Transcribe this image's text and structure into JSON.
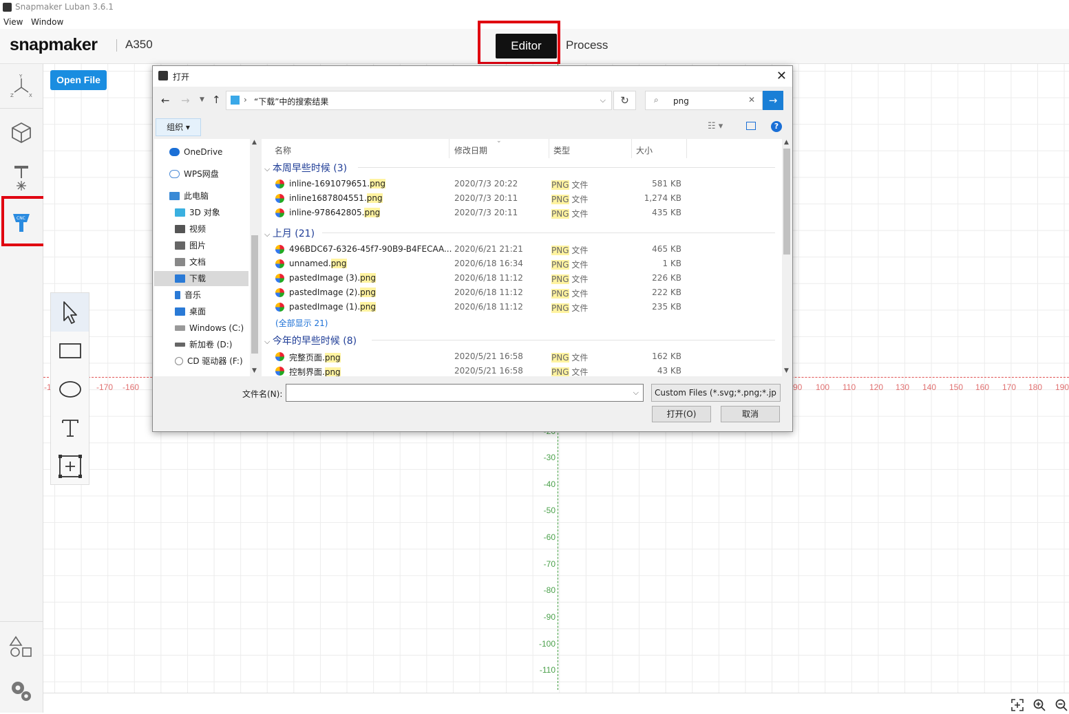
{
  "app": {
    "title": "Snapmaker Luban 3.6.1",
    "menu": [
      "View",
      "Window"
    ]
  },
  "header": {
    "logo": "snapmaker",
    "machine": "A350",
    "tabs": {
      "editor": "Editor",
      "process": "Process"
    }
  },
  "sidebar": {
    "items": [
      "axes-icon",
      "cube-icon",
      "laser-icon",
      "cnc-icon",
      "shapes-icon",
      "gear-icon"
    ],
    "active": "cnc-icon"
  },
  "toolbar": {
    "open_file": "Open File"
  },
  "canvas": {
    "x_ticks_left": [
      "-1",
      "-170",
      "-160"
    ],
    "x_ticks_right": [
      "90",
      "100",
      "110",
      "120",
      "130",
      "140",
      "150",
      "160",
      "170",
      "180",
      "190"
    ],
    "y_ticks": [
      "-20",
      "-30",
      "-40",
      "-50",
      "-60",
      "-70",
      "-80",
      "-90",
      "-100",
      "-110"
    ]
  },
  "tools": [
    "pointer-icon",
    "rectangle-icon",
    "ellipse-icon",
    "text-icon",
    "add-frame-icon"
  ],
  "dialog": {
    "title": "打开",
    "breadcrumb": "“下载”中的搜索结果",
    "search_value": "png",
    "organize": "组织 ▾",
    "tree": [
      {
        "label": "OneDrive",
        "icon": "cloud-icon",
        "color": "#1a6fd6"
      },
      {
        "label": "WPS网盘",
        "icon": "cloud-outline-icon",
        "color": "#4a8ad6"
      },
      {
        "label": "此电脑",
        "icon": "computer-icon",
        "color": "#3a8ad6"
      },
      {
        "label": "3D 对象",
        "icon": "3d-objects-icon",
        "color": "#3ab0e0"
      },
      {
        "label": "视频",
        "icon": "video-icon",
        "color": "#555"
      },
      {
        "label": "图片",
        "icon": "pictures-icon",
        "color": "#666"
      },
      {
        "label": "文档",
        "icon": "documents-icon",
        "color": "#777"
      },
      {
        "label": "下载",
        "icon": "download-icon",
        "color": "#2a7ad6"
      },
      {
        "label": "音乐",
        "icon": "music-icon",
        "color": "#2a7ad6"
      },
      {
        "label": "桌面",
        "icon": "desktop-icon",
        "color": "#2a7ad6"
      },
      {
        "label": "Windows (C:)",
        "icon": "drive-c-icon",
        "color": "#888"
      },
      {
        "label": "新加卷 (D:)",
        "icon": "drive-d-icon",
        "color": "#666"
      },
      {
        "label": "CD 驱动器 (F:)",
        "icon": "cd-drive-icon",
        "color": "#888"
      }
    ],
    "columns": [
      "名称",
      "修改日期",
      "类型",
      "大小"
    ],
    "groups": [
      {
        "title": "本周早些时候 (3)",
        "files": [
          {
            "name": "inline-1691079651.",
            "ext": "png",
            "date": "2020/7/3 20:22",
            "type_ext": "PNG",
            "type": " 文件",
            "size": "581 KB"
          },
          {
            "name": "inline1687804551.",
            "ext": "png",
            "date": "2020/7/3 20:11",
            "type_ext": "PNG",
            "type": " 文件",
            "size": "1,274 KB"
          },
          {
            "name": "inline-978642805.",
            "ext": "png",
            "date": "2020/7/3 20:11",
            "type_ext": "PNG",
            "type": " 文件",
            "size": "435 KB"
          }
        ]
      },
      {
        "title": "上月 (21)",
        "files": [
          {
            "name": "496BDC67-6326-45f7-90B9-B4FECAA...",
            "ext": "",
            "date": "2020/6/21 21:21",
            "type_ext": "PNG",
            "type": " 文件",
            "size": "465 KB"
          },
          {
            "name": "unnamed.",
            "ext": "png",
            "date": "2020/6/18 16:34",
            "type_ext": "PNG",
            "type": " 文件",
            "size": "1 KB"
          },
          {
            "name": "pastedImage (3).",
            "ext": "png",
            "date": "2020/6/18 11:12",
            "type_ext": "PNG",
            "type": " 文件",
            "size": "226 KB"
          },
          {
            "name": "pastedImage (2).",
            "ext": "png",
            "date": "2020/6/18 11:12",
            "type_ext": "PNG",
            "type": " 文件",
            "size": "222 KB"
          },
          {
            "name": "pastedImage (1).",
            "ext": "png",
            "date": "2020/6/18 11:12",
            "type_ext": "PNG",
            "type": " 文件",
            "size": "235 KB"
          }
        ],
        "show_all": "(全部显示 21)"
      },
      {
        "title": "今年的早些时候 (8)",
        "files": [
          {
            "name": "完整页面.",
            "ext": "png",
            "date": "2020/5/21 16:58",
            "type_ext": "PNG",
            "type": " 文件",
            "size": "162 KB"
          },
          {
            "name": "控制界面.",
            "ext": "png",
            "date": "2020/5/21 16:58",
            "type_ext": "PNG",
            "type": " 文件",
            "size": "43 KB"
          }
        ]
      }
    ],
    "filename_label": "文件名(N):",
    "filename_value": "",
    "filter": "Custom Files (*.svg;*.png;*.jp",
    "open_button": "打开(O)",
    "cancel_button": "取消"
  }
}
